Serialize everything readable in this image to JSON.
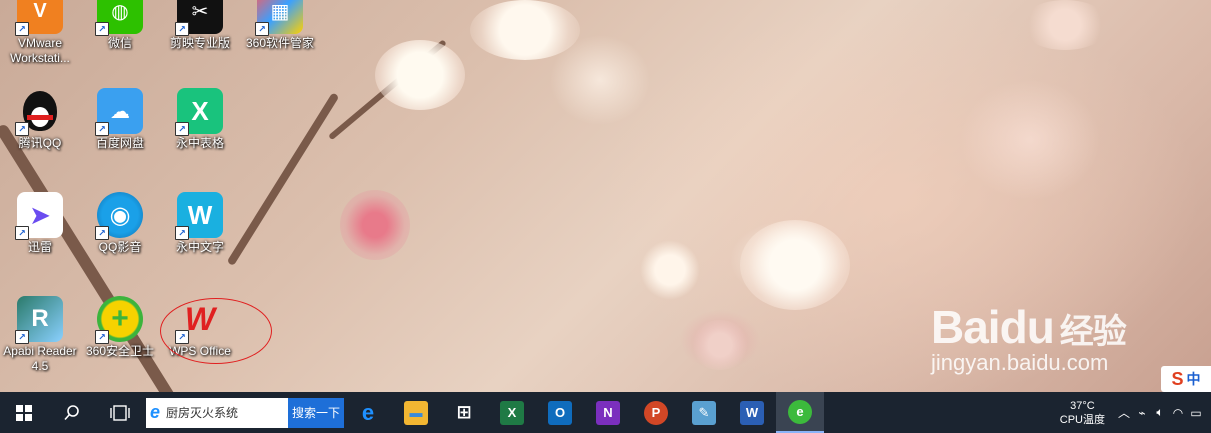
{
  "desktop_icons": [
    {
      "label": "VMware Workstati...",
      "icon": "vmware-icon",
      "color": "#f08020"
    },
    {
      "label": "微信",
      "icon": "wechat-icon",
      "color": "#2dc100"
    },
    {
      "label": "剪映专业版",
      "icon": "jianying-icon",
      "color": "#111111"
    },
    {
      "label": "360软件管家",
      "icon": "360-software-icon",
      "color": "#ff5a5a"
    },
    {
      "label": "腾讯QQ",
      "icon": "qq-icon",
      "color": "#111111"
    },
    {
      "label": "百度网盘",
      "icon": "baidu-netdisk-icon",
      "color": "#3aa0f0"
    },
    {
      "label": "永中表格",
      "icon": "yozo-sheet-icon",
      "color": "#19c37d"
    },
    {
      "label": "迅雷",
      "icon": "xunlei-icon",
      "color": "#ffffff"
    },
    {
      "label": "QQ影音",
      "icon": "qq-player-icon",
      "color": "#1aa0e8"
    },
    {
      "label": "永中文字",
      "icon": "yozo-writer-icon",
      "color": "#1ab0e0"
    },
    {
      "label": "Apabi Reader 4.5",
      "icon": "apabi-reader-icon",
      "color": "#2a7a6a"
    },
    {
      "label": "360安全卫士",
      "icon": "360-safe-icon",
      "color": "#f6d200"
    },
    {
      "label": "WPS Office",
      "icon": "wps-office-icon",
      "color": "#e02020"
    }
  ],
  "watermark": {
    "logo": "Bai",
    "logo_mid": "du",
    "logo_cn": "经验",
    "url": "jingyan.baidu.com"
  },
  "ime": {
    "label": "中",
    "logo": "S"
  },
  "taskbar": {
    "search_text": "厨房灭火系统",
    "search_button": "搜索一下",
    "apps": [
      {
        "name": "edge-icon",
        "glyph": "e",
        "color": "#1e90ff"
      },
      {
        "name": "file-explorer-icon",
        "glyph": "▬",
        "color": "#f2b632"
      },
      {
        "name": "store-icon",
        "glyph": "⊞",
        "color": "#ffffff"
      },
      {
        "name": "excel-icon",
        "glyph": "X",
        "color": "#1f7a45"
      },
      {
        "name": "outlook-icon",
        "glyph": "O",
        "color": "#0f6cbd"
      },
      {
        "name": "onenote-icon",
        "glyph": "N",
        "color": "#7b2fbe"
      },
      {
        "name": "powerpoint-icon",
        "glyph": "P",
        "color": "#d24726"
      },
      {
        "name": "paint-icon",
        "glyph": "✎",
        "color": "#5aa0d0"
      },
      {
        "name": "word-icon",
        "glyph": "W",
        "color": "#2b5fb4"
      },
      {
        "name": "browser-360-icon",
        "glyph": "e",
        "color": "#3cba3c"
      }
    ],
    "cpu_temp": "37°C",
    "cpu_label": "CPU温度"
  }
}
